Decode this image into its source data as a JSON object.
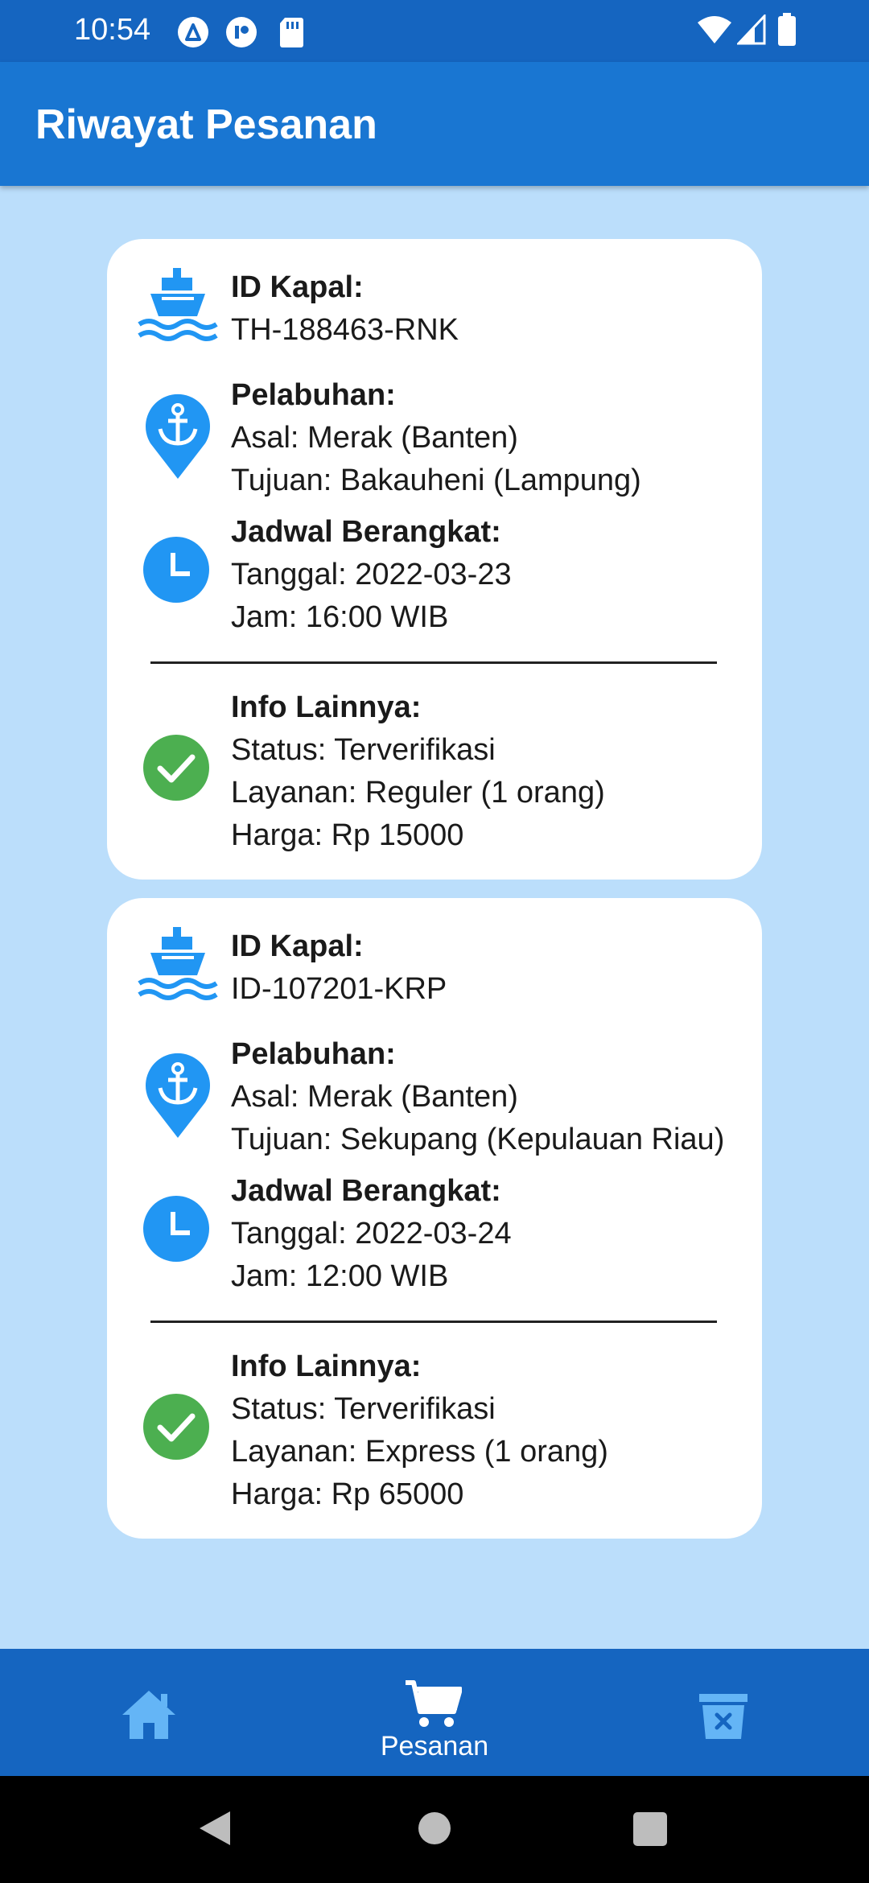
{
  "status_bar": {
    "time": "10:54",
    "left_icons": [
      "app-a-icon",
      "app-b-icon",
      "sd-card-icon"
    ],
    "right_icons": [
      "wifi-icon",
      "signal-icon",
      "battery-icon"
    ]
  },
  "app_bar": {
    "title": "Riwayat Pesanan"
  },
  "orders": [
    {
      "ship_label": "ID Kapal:",
      "ship_id": "TH-188463-RNK",
      "port_label": "Pelabuhan:",
      "origin": "Asal: Merak (Banten)",
      "destination": "Tujuan: Bakauheni (Lampung)",
      "schedule_label": "Jadwal Berangkat:",
      "date": "Tanggal: 2022-03-23",
      "time": "Jam: 16:00 WIB",
      "info_label": "Info Lainnya:",
      "status": "Status: Terverifikasi",
      "service": "Layanan: Reguler (1 orang)",
      "price": "Harga: Rp 15000"
    },
    {
      "ship_label": "ID Kapal:",
      "ship_id": "ID-107201-KRP",
      "port_label": "Pelabuhan:",
      "origin": "Asal: Merak (Banten)",
      "destination": "Tujuan: Sekupang (Kepulauan Riau)",
      "schedule_label": "Jadwal Berangkat:",
      "date": "Tanggal: 2022-03-24",
      "time": "Jam: 12:00 WIB",
      "info_label": "Info Lainnya:",
      "status": "Status: Terverifikasi",
      "service": "Layanan: Express (1 orang)",
      "price": "Harga: Rp 65000"
    }
  ],
  "bottom_nav": {
    "items": [
      {
        "icon": "home-icon",
        "label": ""
      },
      {
        "icon": "cart-icon",
        "label": "Pesanan"
      },
      {
        "icon": "trash-icon",
        "label": ""
      }
    ],
    "active_index": 1
  },
  "colors": {
    "status_bar": "#1565C0",
    "app_bar": "#1976D2",
    "background": "#BBDEFB",
    "icon_blue": "#2196F3",
    "check_green": "#4CAF50"
  }
}
